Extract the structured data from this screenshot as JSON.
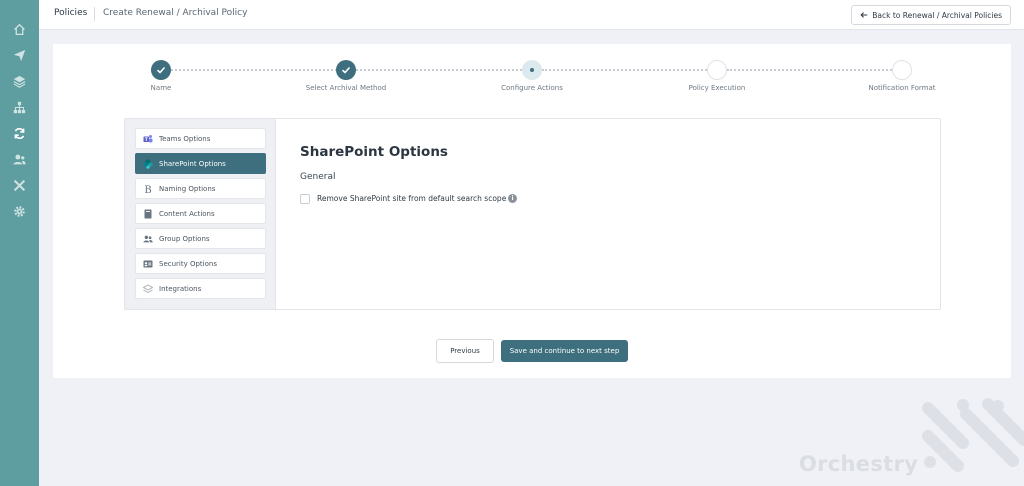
{
  "rail": {
    "items": [
      {
        "icon": "home-icon",
        "active": false
      },
      {
        "icon": "send-icon",
        "active": false
      },
      {
        "icon": "layers-icon",
        "active": false
      },
      {
        "icon": "sitemap-icon",
        "active": false
      },
      {
        "icon": "sync-icon",
        "active": true
      },
      {
        "icon": "users-icon",
        "active": false
      },
      {
        "icon": "tools-icon",
        "active": false
      },
      {
        "icon": "gear-icon",
        "active": false
      }
    ]
  },
  "header": {
    "breadcrumb_root": "Policies",
    "breadcrumb_current": "Create Renewal / Archival Policy",
    "back_label": "Back to Renewal / Archival Policies"
  },
  "stepper": {
    "steps": [
      {
        "label": "Name",
        "state": "done"
      },
      {
        "label": "Select Archival Method",
        "state": "done"
      },
      {
        "label": "Configure Actions",
        "state": "current"
      },
      {
        "label": "Policy Execution",
        "state": "todo"
      },
      {
        "label": "Notification Format",
        "state": "todo"
      }
    ]
  },
  "options_nav": {
    "items": [
      {
        "label": "Teams Options",
        "icon": "teams-icon",
        "active": false
      },
      {
        "label": "SharePoint Options",
        "icon": "sharepoint-icon",
        "active": true
      },
      {
        "label": "Naming Options",
        "icon": "bold-b-icon",
        "active": false
      },
      {
        "label": "Content Actions",
        "icon": "book-icon",
        "active": false
      },
      {
        "label": "Group Options",
        "icon": "group-icon",
        "active": false
      },
      {
        "label": "Security Options",
        "icon": "id-card-icon",
        "active": false
      },
      {
        "label": "Integrations",
        "icon": "layers-icon",
        "active": false
      }
    ]
  },
  "content": {
    "title": "SharePoint Options",
    "section": "General",
    "checkbox_label": "Remove SharePoint site from default search scope",
    "checkbox_checked": false
  },
  "footer": {
    "previous_label": "Previous",
    "next_label": "Save and continue to next step"
  },
  "brand": {
    "watermark": "Orchestry"
  },
  "colors": {
    "rail": "#5f9ea0",
    "primary": "#3e6f7f",
    "background": "#f0f1f6"
  }
}
